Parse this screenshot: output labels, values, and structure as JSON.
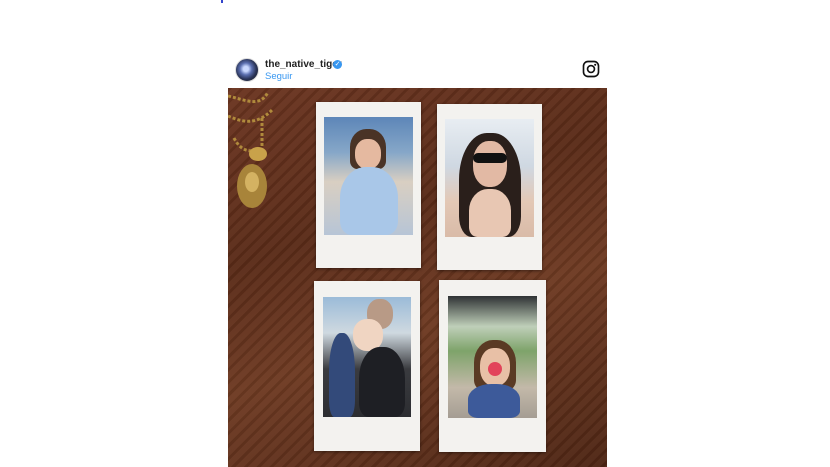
{
  "post": {
    "username": "the_native_tiger",
    "follow_label": "Seguir"
  },
  "icons": {
    "verified": "verified-badge-icon",
    "instagram": "instagram-icon"
  },
  "colors": {
    "link_blue": "#3897f0",
    "wood": "#5a2b18",
    "polaroid_frame": "#f3f2ef"
  },
  "photo": {
    "polaroids": [
      {
        "content": "girl-in-blue-dress"
      },
      {
        "content": "woman-in-sunglasses"
      },
      {
        "content": "baby-held-by-man"
      },
      {
        "content": "child-with-lollipop"
      }
    ]
  }
}
